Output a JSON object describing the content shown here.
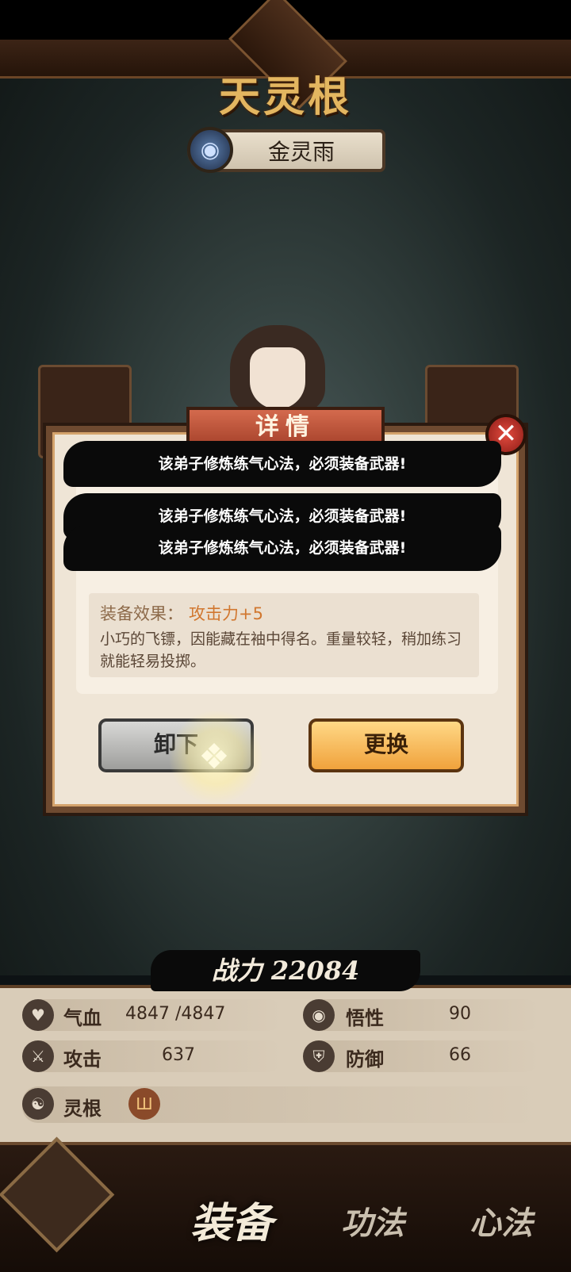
{
  "header": {
    "title": "天灵根",
    "character_name": "金灵雨"
  },
  "dialog": {
    "title": "详情",
    "toasts": [
      "该弟子修炼练气心法，必须装备武器!",
      "该弟子修炼练气心法，必须装备武器!",
      "该弟子修炼练气心法，必须装备武器!"
    ],
    "effect_label": "装备效果：",
    "effect_value": "攻击力+5",
    "description": "小巧的飞镖，因能藏在袖中得名。重量较轻，稍加练习就能轻易投掷。",
    "unequip_label": "卸下",
    "swap_label": "更换",
    "close_icon": "close-icon"
  },
  "stats": {
    "power_label": "战力",
    "power_value": "22084",
    "hp_label": "气血",
    "hp_value": "4847 /4847",
    "insight_label": "悟性",
    "insight_value": "90",
    "attack_label": "攻击",
    "attack_value": "637",
    "defense_label": "防御",
    "defense_value": "66",
    "root_label": "灵根"
  },
  "tabs": {
    "equip": "装备",
    "skill": "功法",
    "mind": "心法"
  }
}
